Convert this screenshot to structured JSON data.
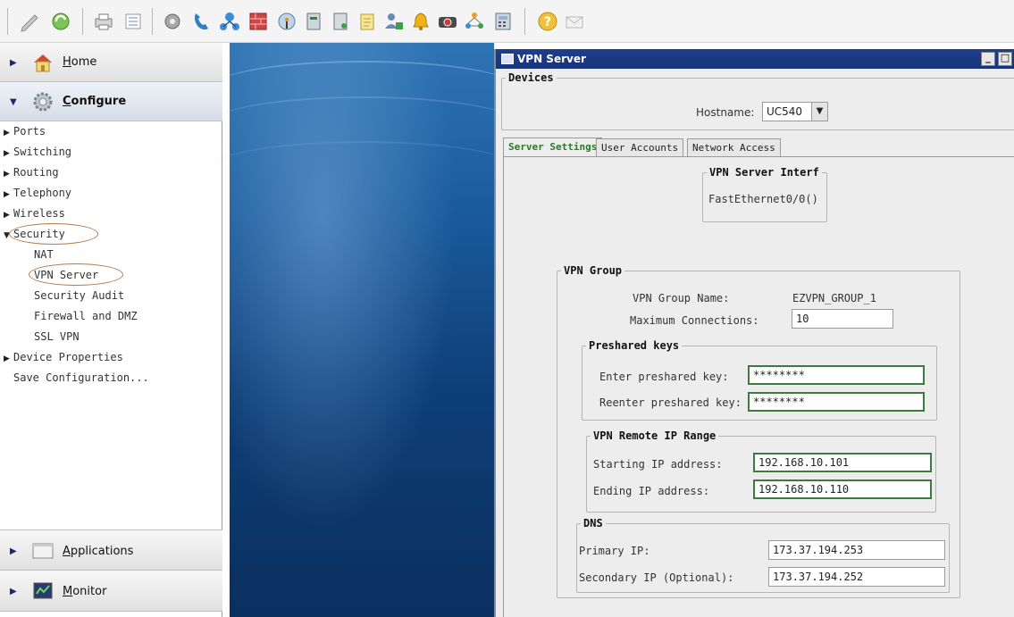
{
  "toolbar": {
    "icons": [
      "edit-icon",
      "refresh-icon",
      "print-icon",
      "list-icon",
      "config-icon",
      "phone-icon",
      "network-icon",
      "firewall-icon",
      "wireless-icon",
      "device-icon",
      "server-icon",
      "notes-icon",
      "users-icon",
      "alarm-icon",
      "camera-icon",
      "topology-icon",
      "calculator-icon",
      "help-icon",
      "mail-icon"
    ]
  },
  "nav": {
    "home_label": "Home",
    "configure_label": "Configure",
    "items": [
      "Ports",
      "Switching",
      "Routing",
      "Telephony",
      "Wireless",
      "Security"
    ],
    "security_children": [
      "NAT",
      "VPN Server",
      "Security Audit",
      "Firewall and DMZ",
      "SSL VPN"
    ],
    "device_properties": "Device Properties",
    "save_configuration": "Save Configuration...",
    "applications_label": "Applications",
    "monitor_label": "Monitor"
  },
  "window": {
    "title": "VPN Server",
    "controls": [
      "_",
      "□"
    ],
    "devices": {
      "legend": "Devices",
      "hostname_label": "Hostname:",
      "hostname_value": "UC540"
    },
    "tabs": [
      "Server Settings",
      "User Accounts",
      "Network Access"
    ],
    "active_tab": "Server Settings",
    "interface": {
      "legend": "VPN Server Interf",
      "value": "FastEthernet0/0()"
    },
    "vpn_group": {
      "legend": "VPN Group",
      "name_label": "VPN Group Name:",
      "name_value": "EZVPN_GROUP_1",
      "max_label": "Maximum Connections:",
      "max_value": "10"
    },
    "preshared": {
      "legend": "Preshared keys",
      "enter_label": "Enter preshared key:",
      "enter_value": "********",
      "reenter_label": "Reenter preshared key:",
      "reenter_value": "********"
    },
    "remote_range": {
      "legend": "VPN Remote IP Range",
      "start_label": "Starting IP address:",
      "start_value": "192.168.10.101",
      "end_label": "Ending IP address:",
      "end_value": "192.168.10.110"
    },
    "dns": {
      "legend": "DNS",
      "primary_label": "Primary IP:",
      "primary_value": "173.37.194.253",
      "secondary_label": "Secondary IP (Optional):",
      "secondary_value": "173.37.194.252"
    }
  },
  "colors": {
    "title_bar": "#1f3f8c",
    "active_tab_text": "#2a7a2a",
    "input_focus_border": "#3e7a3e",
    "highlight_circle": "#b07a4a"
  }
}
